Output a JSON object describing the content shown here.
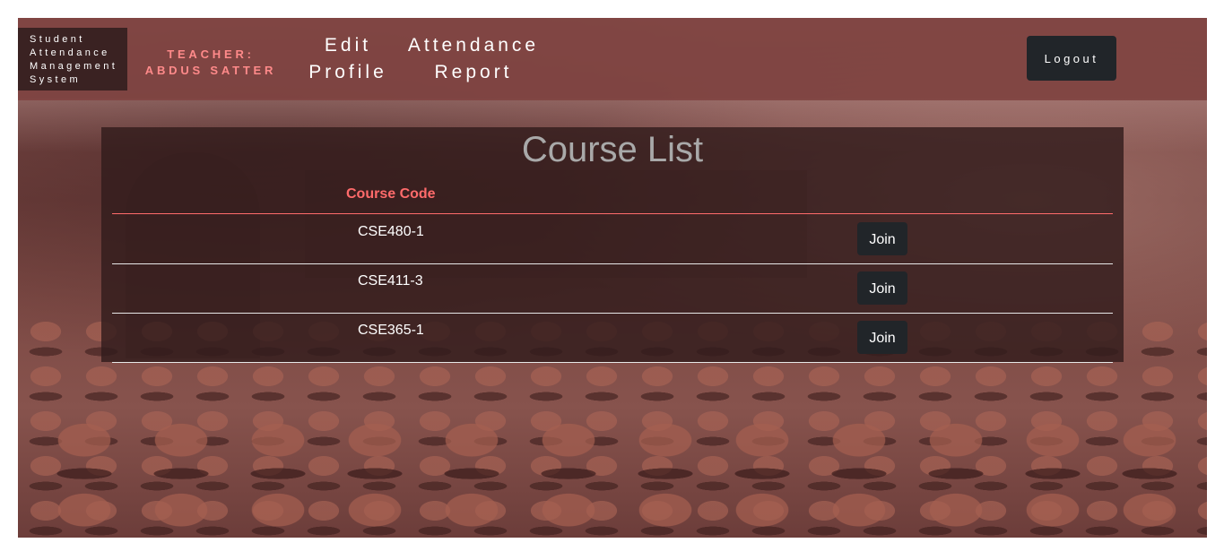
{
  "brand": {
    "lines": [
      "Student",
      "Attendance",
      "Management",
      "System"
    ]
  },
  "teacher": {
    "label": "TEACHER:",
    "name": "ABDUS SATTER"
  },
  "nav": {
    "edit_profile": [
      "Edit",
      "Profile"
    ],
    "attendance_report": [
      "Attendance",
      "Report"
    ],
    "logout_label": "Logout"
  },
  "main": {
    "title": "Course List",
    "column_header": "Course Code",
    "courses": [
      {
        "code": "CSE480-1",
        "action": "Join"
      },
      {
        "code": "CSE411-3",
        "action": "Join"
      },
      {
        "code": "CSE365-1",
        "action": "Join"
      }
    ]
  },
  "colors": {
    "navbar": "#804442",
    "brand_box": "#3a2222",
    "teacher_text": "#ff8a8a",
    "accent_red": "#ff6b6b",
    "button_dark": "#212529",
    "panel": "#321c1c",
    "title_gray": "#a9a9a9"
  }
}
